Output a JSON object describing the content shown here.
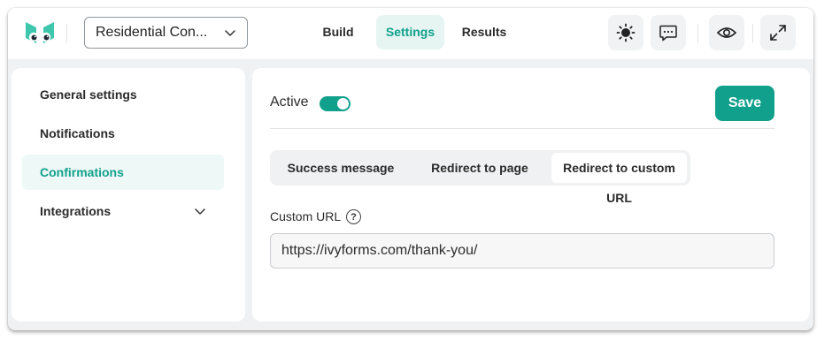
{
  "header": {
    "form_name": "Residential Con...",
    "tabs": [
      {
        "label": "Build"
      },
      {
        "label": "Settings",
        "active": true
      },
      {
        "label": "Results"
      }
    ],
    "icons": [
      "sun-icon",
      "comment-icon",
      "eye-icon",
      "expand-icon"
    ]
  },
  "sidebar": {
    "items": [
      {
        "label": "General settings"
      },
      {
        "label": "Notifications"
      },
      {
        "label": "Confirmations",
        "active": true
      },
      {
        "label": "Integrations",
        "has_dropdown": true
      }
    ]
  },
  "main": {
    "active_label": "Active",
    "active_on": true,
    "save_label": "Save",
    "segments": [
      {
        "label": "Success message"
      },
      {
        "label": "Redirect to page"
      },
      {
        "label": "Redirect to custom URL",
        "active": true
      }
    ],
    "custom_url_label": "Custom URL",
    "help_glyph": "?",
    "custom_url_value": "https://ivyforms.com/thank-you/"
  },
  "colors": {
    "accent": "#11a08c",
    "accent_bg": "#e6f5f2"
  }
}
